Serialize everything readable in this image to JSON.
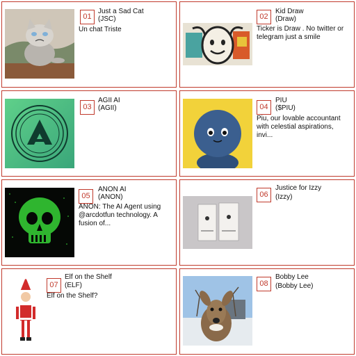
{
  "colors": {
    "accent": "#c0392b",
    "background": "#ffffff",
    "text": "#111111"
  },
  "cards": [
    {
      "rank": "01",
      "name": "Just a Sad Cat",
      "ticker": "(JSC)",
      "description": "Un chat Triste",
      "image": "grumpy-cat-image"
    },
    {
      "rank": "02",
      "name": "Kid Draw",
      "ticker": "(Draw)",
      "description": "Ticker is Draw . No twitter or telegram just a smile",
      "image": "kid-drawing-image"
    },
    {
      "rank": "03",
      "name": "AGII AI",
      "ticker": "(AGII)",
      "description": "",
      "image": "agii-logo-image"
    },
    {
      "rank": "04",
      "name": "PIU",
      "ticker": "($PIU)",
      "description": "Piu, our lovable accountant with celestial aspirations, invi...",
      "image": "blue-plush-toy-image"
    },
    {
      "rank": "05",
      "name": "ANON AI",
      "ticker": "(ANON)",
      "description": "ANON: The AI Agent using @arcdotfun technology. A fusion of...",
      "image": "green-skull-image"
    },
    {
      "rank": "06",
      "name": "Justice for Izzy",
      "ticker": "(Izzy)",
      "description": "",
      "image": "izzy-cards-image"
    },
    {
      "rank": "07",
      "name": "Elf on the Shelf",
      "ticker": "(ELF)",
      "description": "Elf on the Shelf?",
      "image": "elf-doll-image"
    },
    {
      "rank": "08",
      "name": "Bobby Lee",
      "ticker": "(Bobby Lee)",
      "description": "",
      "image": "deer-image"
    }
  ]
}
